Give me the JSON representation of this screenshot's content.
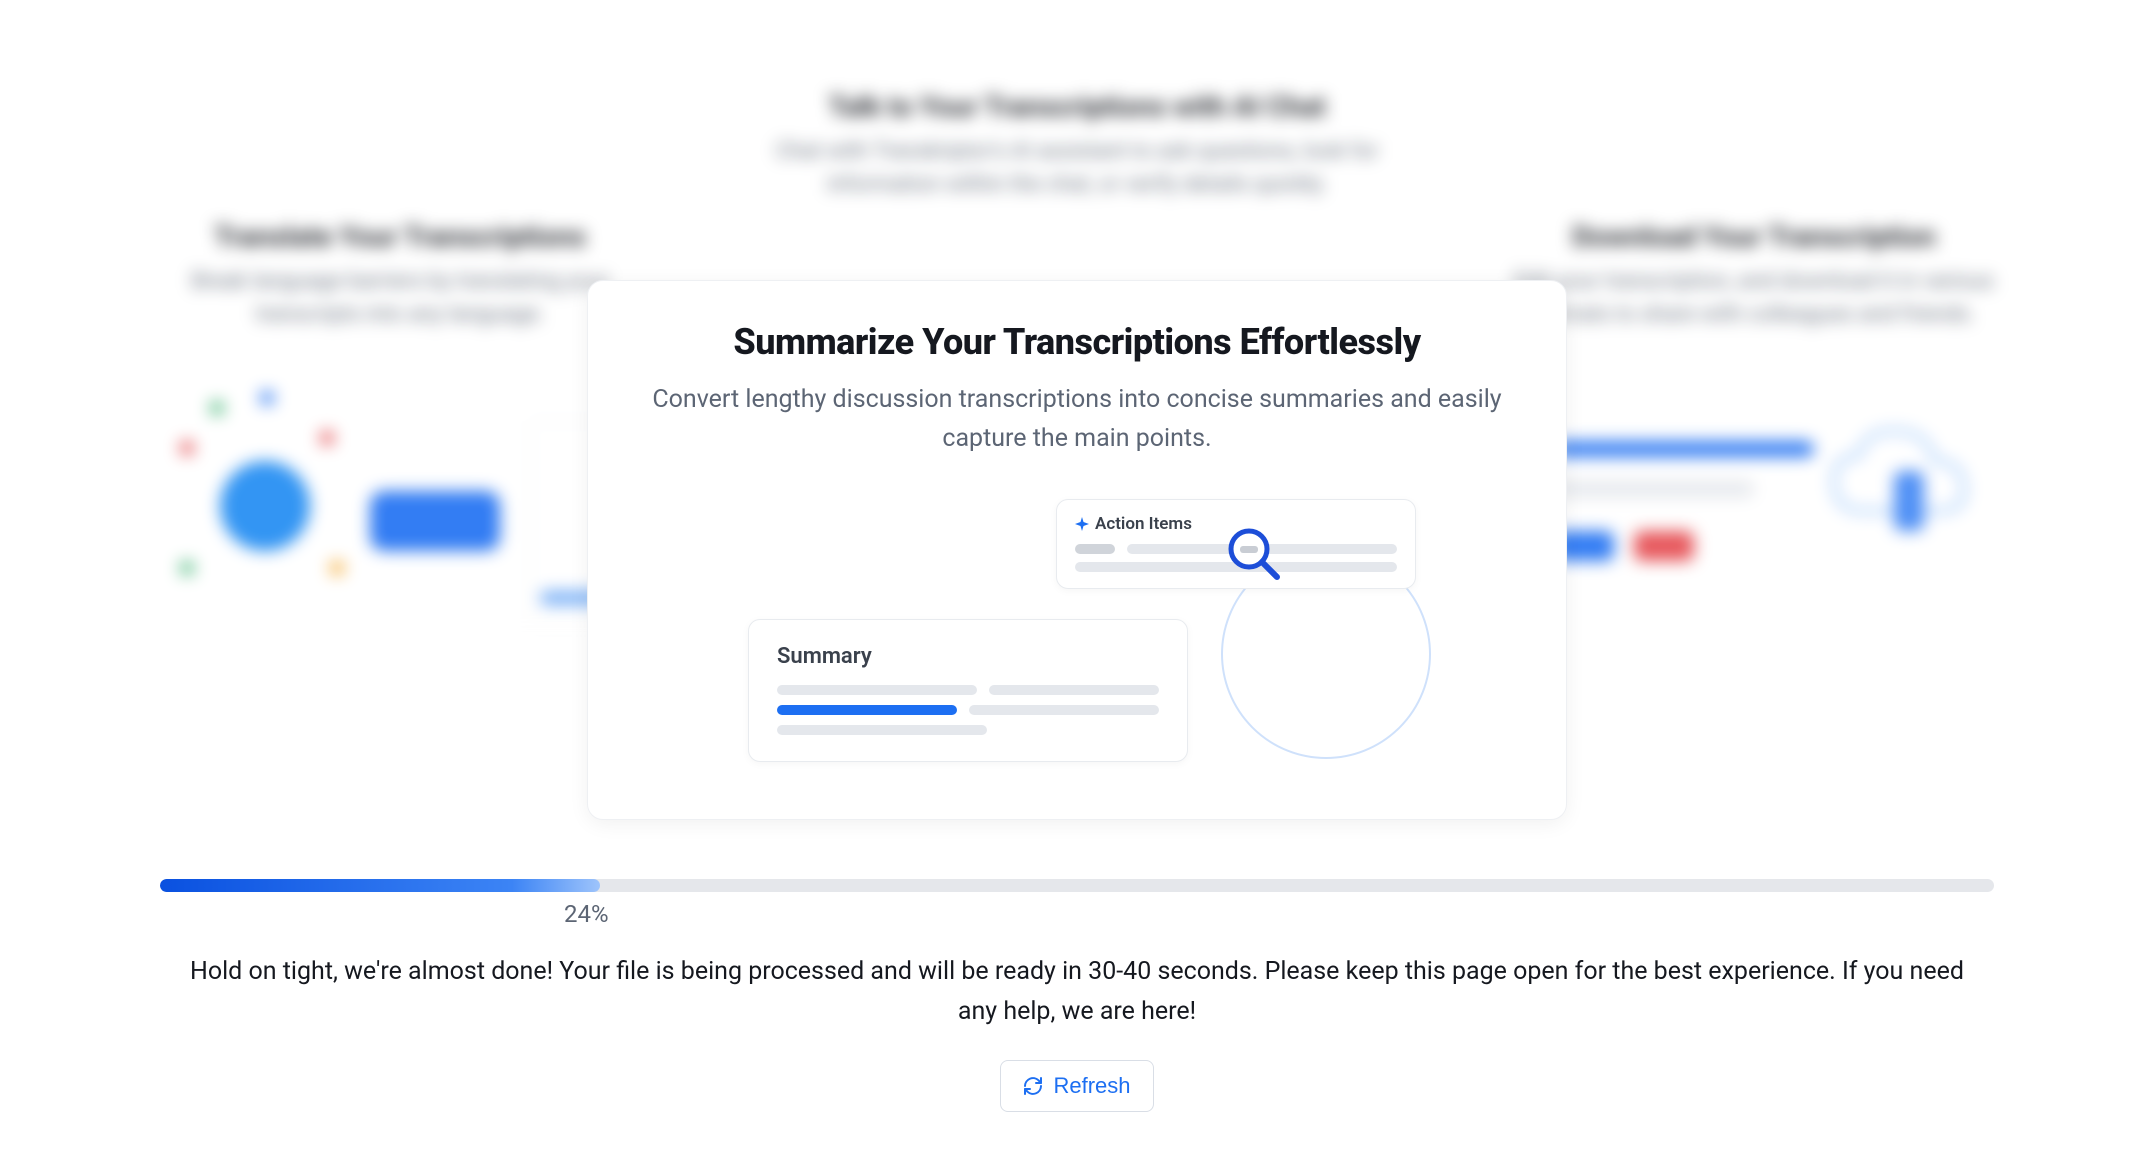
{
  "cards": {
    "top": {
      "title": "Talk to Your Transcriptions with AI Chat",
      "subtitle": "Chat with Transkriptor's AI assistant to ask questions, look for information within the chat, or verify details quickly."
    },
    "left": {
      "title": "Translate Your Transcriptions",
      "subtitle": "Break language barriers by translating your transcripts into any language."
    },
    "right": {
      "title": "Download Your Transcription",
      "subtitle": "Edit your transcription, and download it in various formats to share with colleagues and friends."
    },
    "center": {
      "title": "Summarize Your Transcriptions Effortlessly",
      "subtitle": "Convert lengthy discussion transcriptions into concise summaries and easily capture the main points.",
      "summary_label": "Summary",
      "action_items_label": "Action Items"
    }
  },
  "progress": {
    "percent_label": "24%",
    "percent_value": 24,
    "message": "Hold on tight, we're almost done! Your file is being processed and will be ready in 30-40 seconds. Please keep this page open for the best experience. If you need any help, we are here!",
    "refresh_label": "Refresh"
  }
}
